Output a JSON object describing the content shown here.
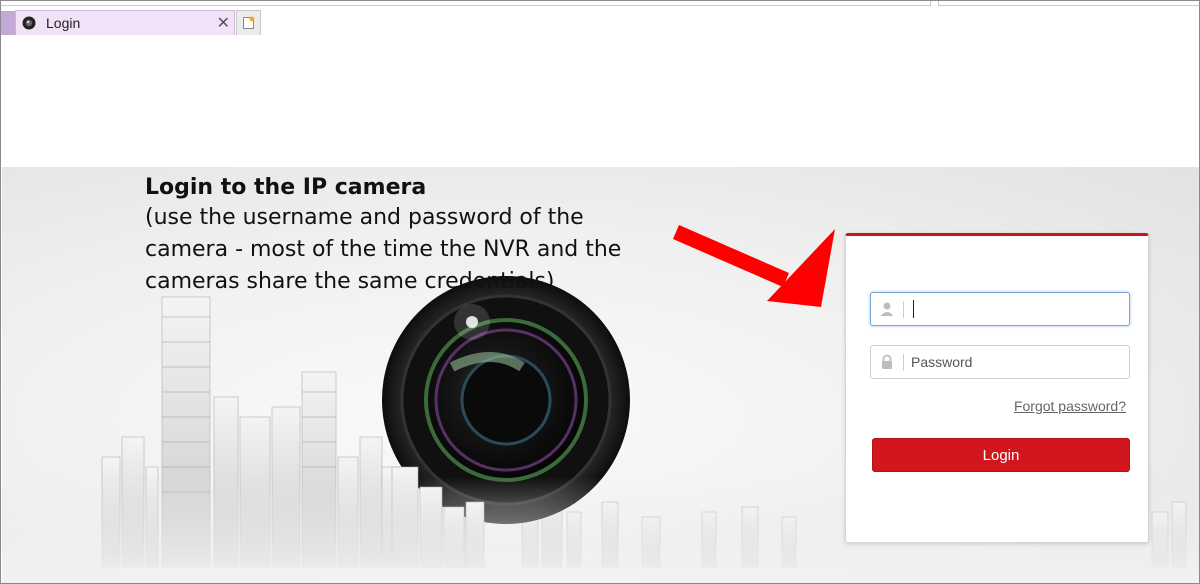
{
  "browser": {
    "tab": {
      "title": "Login",
      "close_glyph": "✕",
      "favicon": "camera-favicon"
    },
    "new_tab_icon": "new-tab-icon"
  },
  "annotation": {
    "title": "Login to the IP camera",
    "lines": [
      "(use the username and password of the",
      "camera - most of the time the NVR and the",
      "cameras share the same credentials)"
    ],
    "arrow_color": "#ff0000"
  },
  "login": {
    "username": {
      "value": "",
      "placeholder": "",
      "icon": "user-icon"
    },
    "password": {
      "value": "",
      "placeholder": "Password",
      "icon": "lock-icon"
    },
    "forgot_label": "Forgot password?",
    "button_label": "Login",
    "accent_color": "#c8161d"
  }
}
